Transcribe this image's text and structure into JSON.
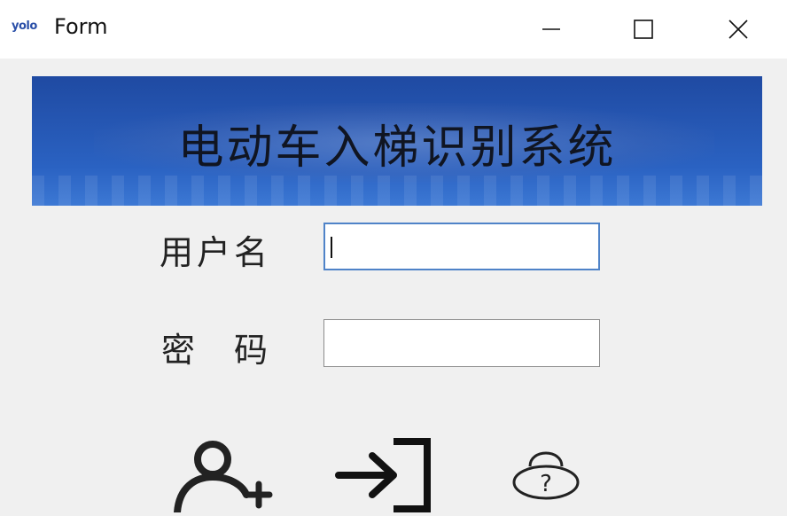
{
  "window": {
    "app_icon_text": "yolo",
    "title": "Form",
    "controls": {
      "minimize_icon": "minimize-icon",
      "maximize_icon": "maximize-icon",
      "close_icon": "close-icon"
    }
  },
  "banner": {
    "title": "电动车入梯识别系统"
  },
  "form": {
    "username_label": "用户名",
    "username_value": "",
    "password_label": "密码",
    "password_value": ""
  },
  "actions": [
    {
      "icon": "add-user-icon"
    },
    {
      "icon": "login-icon"
    },
    {
      "icon": "forgot-password-lock-icon"
    }
  ],
  "colors": {
    "banner_top": "#1f4aa2",
    "banner_bottom": "#3c78d4",
    "focus_border": "#4f83c8",
    "window_bg": "#f0f0f0"
  }
}
